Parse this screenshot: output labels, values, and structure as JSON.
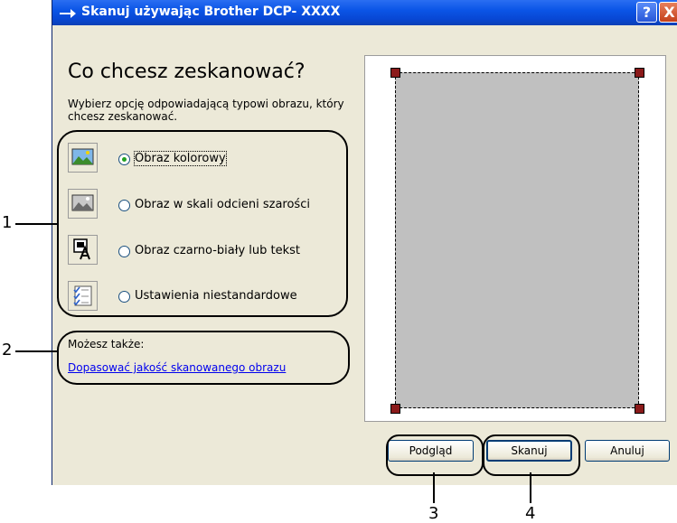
{
  "window": {
    "title": "Skanuj używając Brother DCP- XXXX",
    "help_label": "?",
    "close_label": "X"
  },
  "main": {
    "heading": "Co chcesz zeskanować?",
    "instruction": "Wybierz opcję odpowiadającą typowi obrazu, który chcesz zeskanować.",
    "options": [
      {
        "label": "Obraz kolorowy",
        "selected": true,
        "icon": "color-photo-icon"
      },
      {
        "label": "Obraz w skali odcieni szarości",
        "selected": false,
        "icon": "grayscale-photo-icon"
      },
      {
        "label": "Obraz czarno-biały lub tekst",
        "selected": false,
        "icon": "black-white-text-icon"
      },
      {
        "label": "Ustawienia niestandardowe",
        "selected": false,
        "icon": "custom-settings-icon"
      }
    ],
    "also_label": "Możesz także:",
    "adjust_link": "Dopasować jakość skanowanego obrazu"
  },
  "buttons": {
    "preview": "Podgląd",
    "scan": "Skanuj",
    "cancel": "Anuluj"
  },
  "callouts": [
    "1",
    "2",
    "3",
    "4"
  ],
  "colors": {
    "titlebar": "#0b55e6",
    "dialog_bg": "#ece9d8",
    "handle": "#8b1a1a",
    "link": "#0000ee",
    "radio_dot": "#21a121"
  }
}
